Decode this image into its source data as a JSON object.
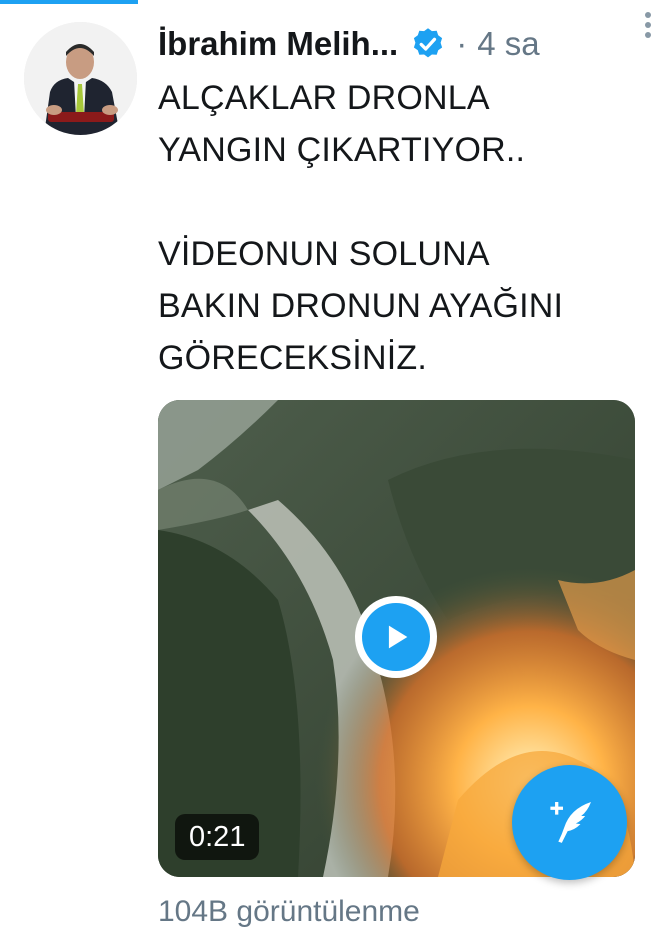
{
  "colors": {
    "accent": "#1da1f2",
    "text": "#14171a",
    "muted": "#657786"
  },
  "tweet": {
    "author_name": "İbrahim Melih...",
    "verified_icon": "verified-badge-icon",
    "separator": "·",
    "timestamp": "4 sa",
    "text": "ALÇAKLAR DRONLA\nYANGIN ÇIKARTIYOR..\n\nVİDEONUN SOLUNA\nBAKIN DRONUN AYAĞINI\nGÖRECEKSİNİZ.",
    "more_icon": "more-vertical-icon",
    "media": {
      "type": "video",
      "play_icon": "play-icon",
      "duration": "0:21"
    },
    "views_partial": "104B görüntülenme"
  },
  "fab": {
    "icon": "compose-tweet-icon"
  }
}
